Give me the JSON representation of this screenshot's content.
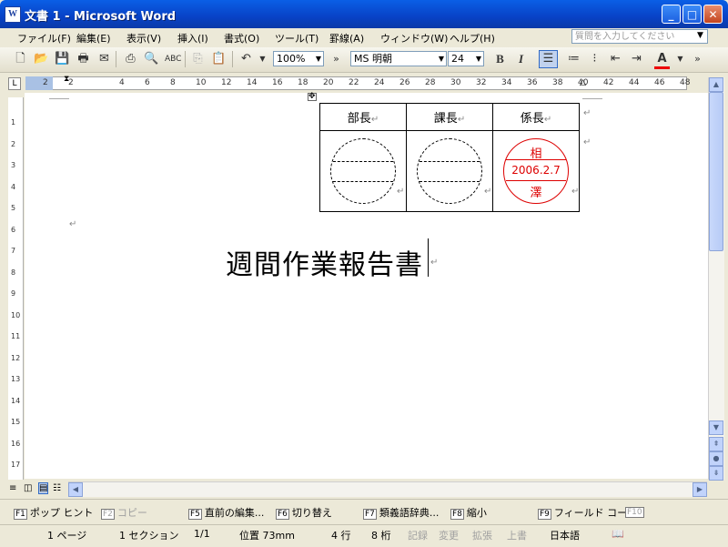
{
  "window": {
    "title": "文書 1 - Microsoft Word",
    "app_icon": "W"
  },
  "menu": [
    "ファイル(F)",
    "編集(E)",
    "表示(V)",
    "挿入(I)",
    "書式(O)",
    "ツール(T)",
    "罫線(A)",
    "ウィンドウ(W)",
    "ヘルプ(H)"
  ],
  "help_search": {
    "placeholder": "質問を入力してください"
  },
  "toolbar": {
    "zoom": "100%",
    "font": "MS 明朝",
    "size": "24",
    "bold": "B",
    "italic": "I"
  },
  "ruler": {
    "marks": [
      "2",
      "2",
      "4",
      "6",
      "8",
      "10",
      "12",
      "14",
      "16",
      "18",
      "20",
      "22",
      "24",
      "26",
      "28",
      "30",
      "32",
      "34",
      "36",
      "38",
      "40",
      "42",
      "44",
      "46",
      "48"
    ]
  },
  "vruler": {
    "marks": [
      "1",
      "2",
      "3",
      "4",
      "5",
      "6",
      "7",
      "8",
      "9",
      "10",
      "11",
      "12",
      "13",
      "14",
      "15",
      "16",
      "17"
    ]
  },
  "document": {
    "approval_headers": [
      "部長",
      "課長",
      "係長"
    ],
    "stamp": {
      "top": "相",
      "date": "2006.2.7",
      "bottom": "澤",
      "color": "#dd0000"
    },
    "title": "週間作業報告書"
  },
  "fkeys": [
    {
      "key": "F1",
      "label": "ポップ ヒント",
      "enabled": true
    },
    {
      "key": "F2",
      "label": "コピー",
      "enabled": false
    },
    {
      "key": "F5",
      "label": "直前の編集...",
      "enabled": true
    },
    {
      "key": "F6",
      "label": "切り替え",
      "enabled": true
    },
    {
      "key": "F7",
      "label": "類義語辞典...",
      "enabled": true
    },
    {
      "key": "F8",
      "label": "縮小",
      "enabled": true
    },
    {
      "key": "F9",
      "label": "フィールド コー...",
      "enabled": true
    },
    {
      "key": "F10",
      "label": "",
      "enabled": false
    }
  ],
  "status": {
    "page": "1 ページ",
    "section": "1 セクション",
    "pages": "1/1",
    "position": "位置 73mm",
    "line": "4 行",
    "column": "8 桁",
    "rec": "記録",
    "trk": "変更",
    "ext": "拡張",
    "ovr": "上書",
    "lang": "日本語"
  }
}
